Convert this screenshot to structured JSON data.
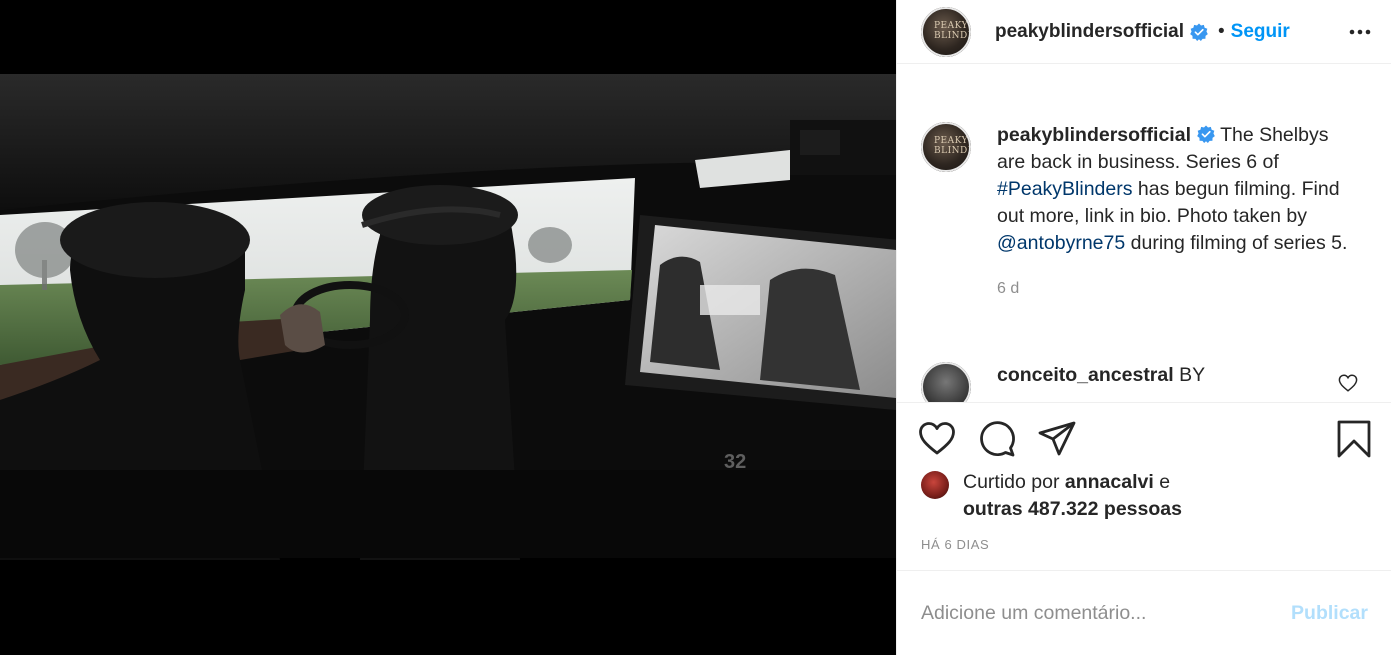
{
  "post": {
    "author": {
      "username": "peakyblindersofficial",
      "verified": true,
      "avatar_text": "PEAKY BLINDERS"
    },
    "follow_label": "Seguir",
    "separator": "•",
    "more_icon": "more-horizontal-icon"
  },
  "media": {
    "type": "image",
    "caption_number": "32"
  },
  "comments": [
    {
      "username": "peakyblindersofficial",
      "verified": true,
      "text_before": "The Shelbys are back in business. Series 6 of ",
      "hashtag": "#PeakyBlinders",
      "text_middle": " has begun filming. Find out more, link in bio. Photo taken by ",
      "mention": "@antobyrne75",
      "text_after": " during filming of series 5.",
      "age": "6 d"
    },
    {
      "username": "conceito_ancestral",
      "text": "BY"
    }
  ],
  "actions": {
    "like_icon": "heart-icon",
    "comment_icon": "comment-icon",
    "share_icon": "share-icon",
    "save_icon": "bookmark-icon"
  },
  "likes": {
    "prefix": "Curtido por ",
    "liker": "annacalvi",
    "conjunction": " e",
    "others": "outras 487.322 pessoas"
  },
  "timestamp": "Há 6 dias",
  "add_comment": {
    "placeholder": "Adicione um comentário...",
    "publish_label": "Publicar"
  },
  "colors": {
    "accent": "#0095f6",
    "link": "#00376b",
    "muted": "#8e8e8e",
    "publish_disabled": "#b2dffc",
    "verified": "#3897f0"
  }
}
